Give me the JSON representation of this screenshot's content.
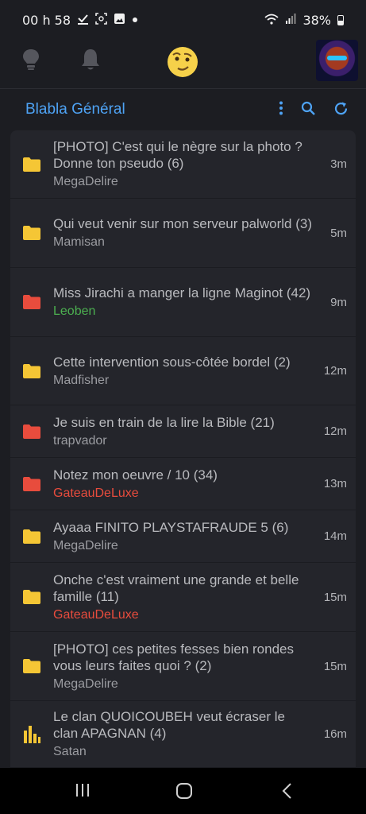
{
  "status": {
    "time": "00 h 58",
    "battery": "38%",
    "icons": [
      "check-download-icon",
      "screenshot-icon",
      "image-icon",
      "dot-icon",
      "wifi-icon",
      "signal-icon",
      "battery-icon"
    ]
  },
  "nav": {
    "icons": [
      "lightbulb-icon",
      "bell-icon",
      "smiley-icon",
      "avatar"
    ]
  },
  "header": {
    "title": "Blabla Général",
    "actions": [
      "more-vertical-icon",
      "search-icon",
      "refresh-icon"
    ]
  },
  "topics": [
    {
      "title": "[PHOTO] C'est qui le nègre sur la photo ? Donne ton pseudo",
      "count": "(6)",
      "author": "MegaDelire",
      "time": "3m",
      "icon": "folder",
      "icon_color": "#f5c635",
      "author_color": "#9b9ca1"
    },
    {
      "title": "Qui veut venir sur mon serveur palworld",
      "count": "(3)",
      "author": "Mamisan",
      "time": "5m",
      "icon": "folder",
      "icon_color": "#f5c635",
      "author_color": "#9b9ca1"
    },
    {
      "title": "Miss Jirachi a manger la ligne Maginot",
      "count": "(42)",
      "author": "Leoben",
      "time": "9m",
      "icon": "folder",
      "icon_color": "#e84c3d",
      "author_color": "#4caf50"
    },
    {
      "title": "Cette intervention sous-côtée bordel",
      "count": "(2)",
      "author": "Madfisher",
      "time": "12m",
      "icon": "folder",
      "icon_color": "#f5c635",
      "author_color": "#9b9ca1"
    },
    {
      "title": "Je suis en train de la lire la Bible",
      "count": "(21)",
      "author": "trapvador",
      "time": "12m",
      "icon": "folder",
      "icon_color": "#e84c3d",
      "author_color": "#9b9ca1"
    },
    {
      "title": "Notez mon oeuvre / 10",
      "count": "(34)",
      "author": "GateauDeLuxe",
      "time": "13m",
      "icon": "folder",
      "icon_color": "#e84c3d",
      "author_color": "#e84c3d"
    },
    {
      "title": "Ayaaa FINITO PLAYSTAFRAUDE 5",
      "count": "(6)",
      "author": "MegaDelire",
      "time": "14m",
      "icon": "folder",
      "icon_color": "#f5c635",
      "author_color": "#9b9ca1"
    },
    {
      "title": "Onche c'est vraiment une grande et belle famille",
      "count": "(11)",
      "author": "GateauDeLuxe",
      "time": "15m",
      "icon": "folder",
      "icon_color": "#f5c635",
      "author_color": "#e84c3d"
    },
    {
      "title": "[PHOTO] ces petites fesses bien rondes vous leurs faites quoi ?",
      "count": "(2)",
      "author": "MegaDelire",
      "time": "15m",
      "icon": "folder",
      "icon_color": "#f5c635",
      "author_color": "#9b9ca1"
    },
    {
      "title": "Le clan QUOICOUBEH veut écraser le clan APAGNAN",
      "count": "(4)",
      "author": "Satan",
      "time": "16m",
      "icon": "poll",
      "icon_color": "#f5c635",
      "author_color": "#9b9ca1"
    }
  ],
  "system_nav": [
    "recents-icon",
    "home-icon",
    "back-icon"
  ]
}
